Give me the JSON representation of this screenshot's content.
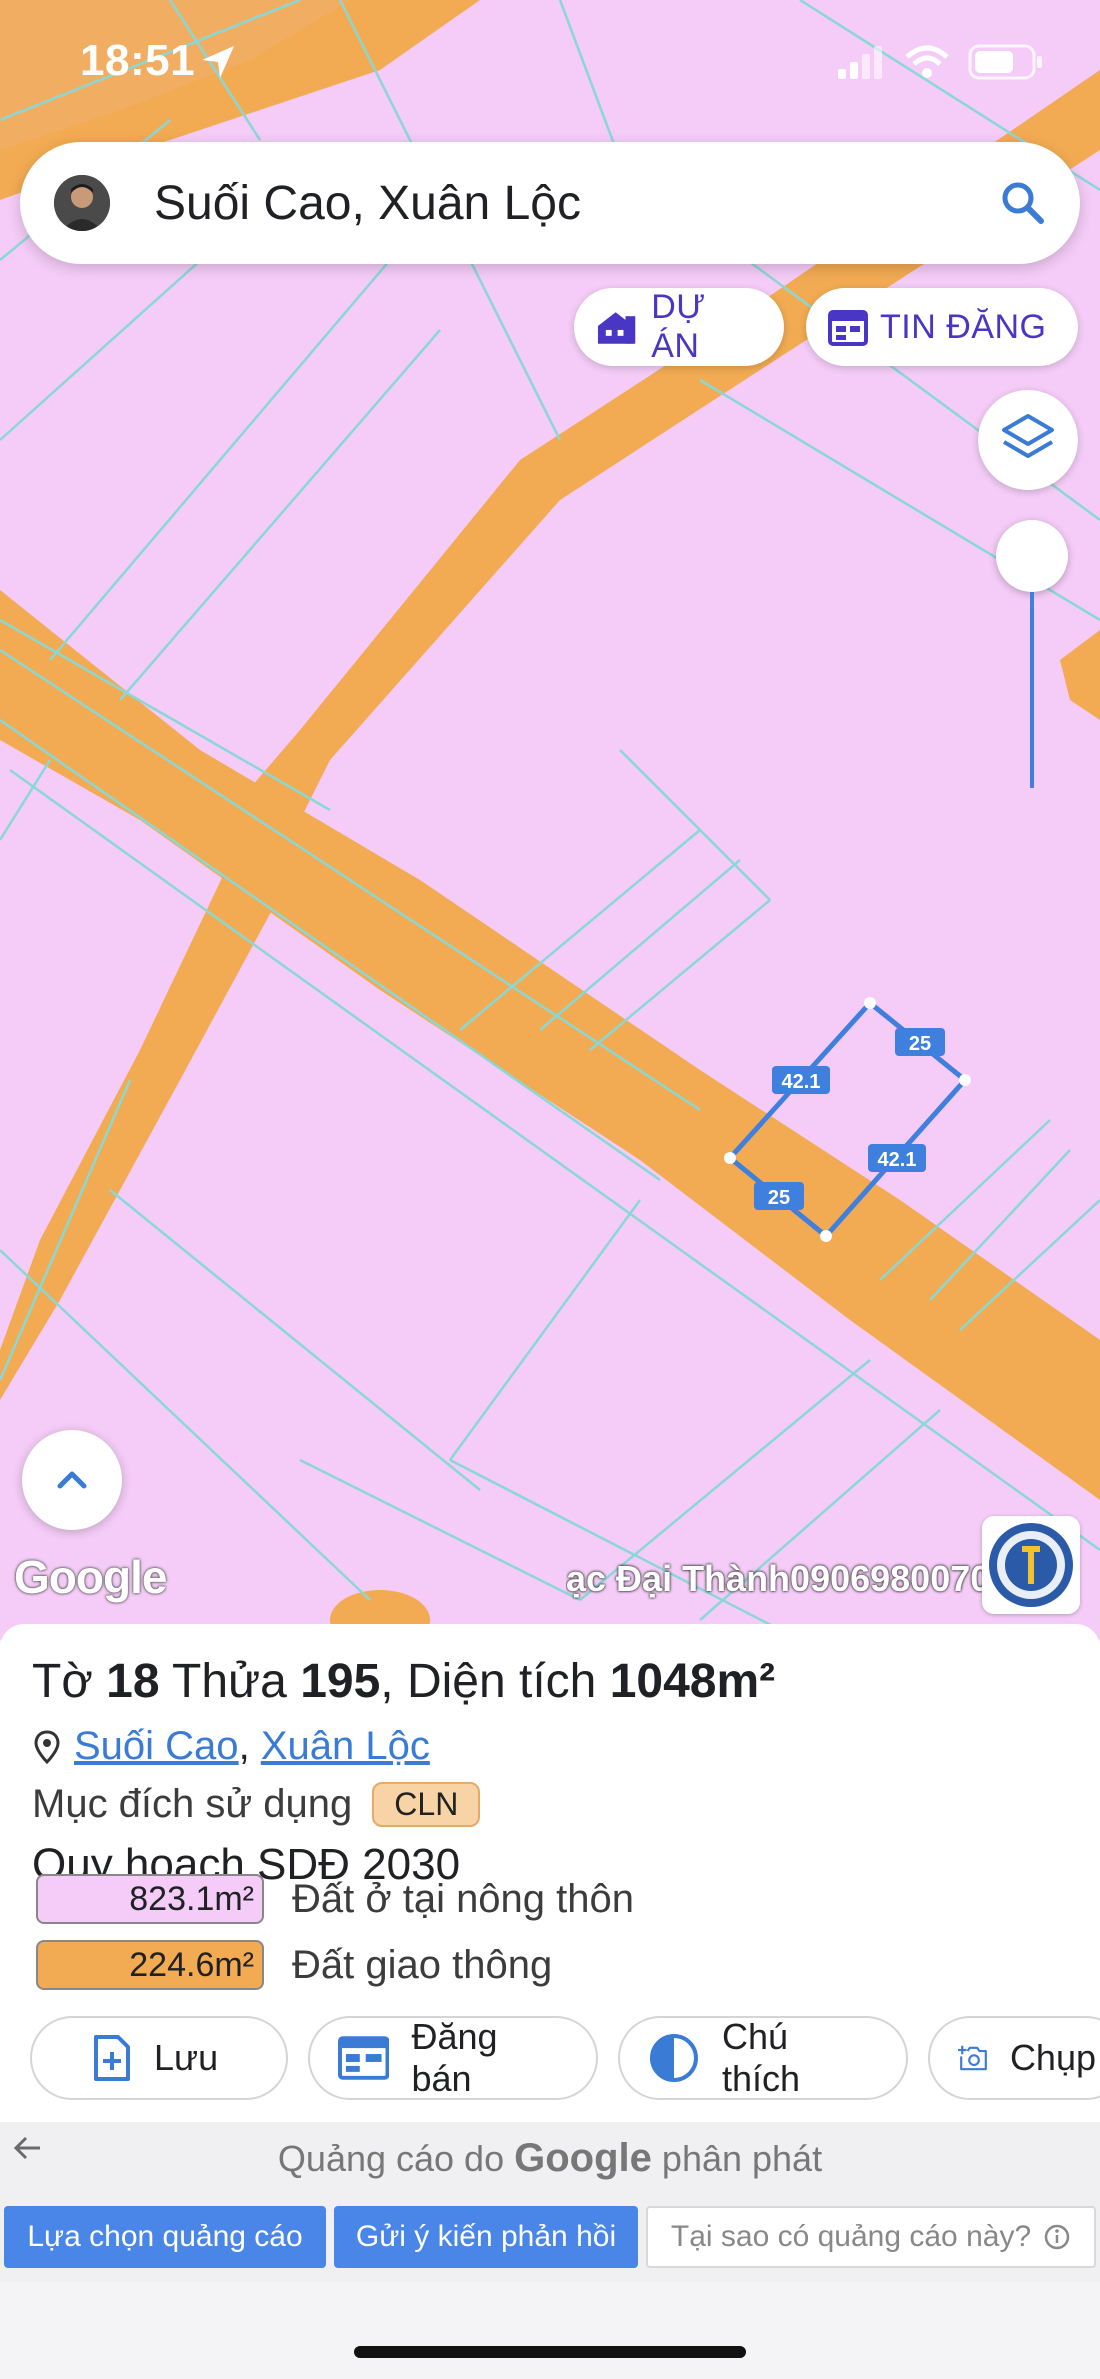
{
  "status_bar": {
    "time": "18:51"
  },
  "search": {
    "query": "Suối Cao, Xuân Lộc"
  },
  "chips": {
    "du_an": "DỰ ÁN",
    "tin_dang": "TIN ĐĂNG"
  },
  "map": {
    "google_logo": "Google",
    "watermark": "ạc Đại Thành0906980070",
    "parcel_edges": {
      "top_right": "25",
      "top_left": "42.1",
      "right": "42.1",
      "bottom": "25"
    },
    "colors": {
      "residential": "#f4ccf7",
      "road": "#f2ab52",
      "parcel_line": "#8ad8d6",
      "selection": "#3f7fde"
    }
  },
  "info": {
    "title_parts": {
      "sheet_label": "Tờ",
      "sheet": "18",
      "plot_label": "Thửa",
      "plot": "195",
      "area_label": ", Diện tích",
      "area": "1048m²"
    },
    "location": {
      "commune": "Suối Cao",
      "district": "Xuân Lộc",
      "separator": ","
    },
    "purpose_label": "Mục đích sử dụng",
    "purpose_code": "CLN",
    "plan_title": "Quy hoạch SDĐ 2030",
    "legend": [
      {
        "value": "823.1m²",
        "label": "Đất ở tại nông thôn",
        "color": "#f4ccf7"
      },
      {
        "value": "224.6m²",
        "label": "Đất giao thông",
        "color": "#f2ab52"
      }
    ]
  },
  "actions": {
    "save": "Lưu",
    "post": "Đăng bán",
    "legend": "Chú thích",
    "capture": "Chụp"
  },
  "ad": {
    "text_before": "Quảng cáo do",
    "brand": "Google",
    "text_after": "phân phát",
    "choices": "Lựa chọn quảng cáo",
    "feedback": "Gửi ý kiến phản hồi",
    "why": "Tại sao có quảng cáo này?"
  }
}
